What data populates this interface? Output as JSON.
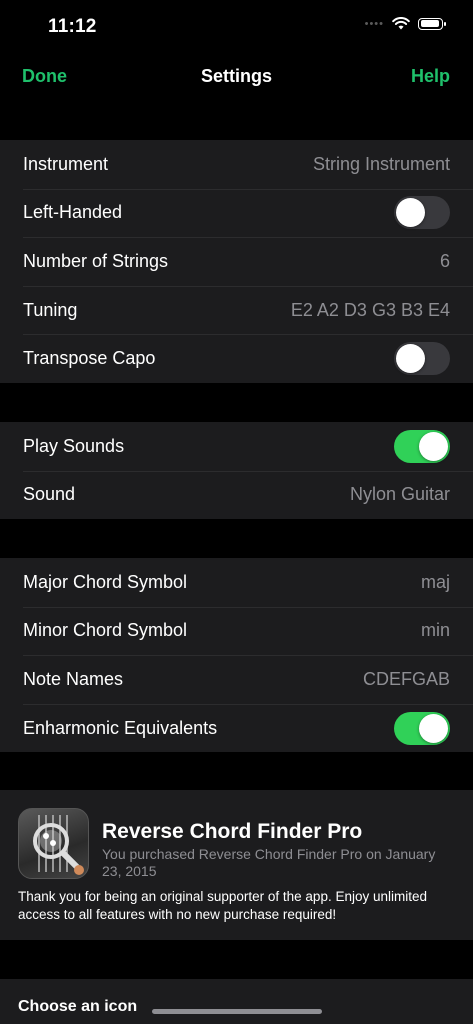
{
  "status": {
    "time": "11:12"
  },
  "nav": {
    "done": "Done",
    "title": "Settings",
    "help": "Help"
  },
  "instrument_group": {
    "instrument": {
      "label": "Instrument",
      "value": "String Instrument"
    },
    "left_handed": {
      "label": "Left-Handed",
      "on": false
    },
    "strings": {
      "label": "Number of Strings",
      "value": "6"
    },
    "tuning": {
      "label": "Tuning",
      "value": "E2 A2 D3 G3 B3 E4"
    },
    "capo": {
      "label": "Transpose Capo",
      "on": false
    }
  },
  "sound_group": {
    "play_sounds": {
      "label": "Play Sounds",
      "on": true
    },
    "sound": {
      "label": "Sound",
      "value": "Nylon Guitar"
    }
  },
  "notation_group": {
    "major": {
      "label": "Major Chord Symbol",
      "value": "maj"
    },
    "minor": {
      "label": "Minor Chord Symbol",
      "value": "min"
    },
    "note_names": {
      "label": "Note Names",
      "value": "CDEFGAB"
    },
    "enharmonic": {
      "label": "Enharmonic Equivalents",
      "on": true
    }
  },
  "pro": {
    "title": "Reverse Chord Finder Pro",
    "subtitle": "You purchased Reverse Chord Finder Pro on January 23, 2015",
    "thanks": "Thank you for being an original supporter of the app. Enjoy unlimited access to all features with no new purchase required!"
  },
  "icon_section": {
    "heading": "Choose an icon"
  },
  "colors": {
    "accent": "#1fc06b",
    "toggle_on": "#30d158",
    "cell_bg": "#1c1c1e"
  }
}
